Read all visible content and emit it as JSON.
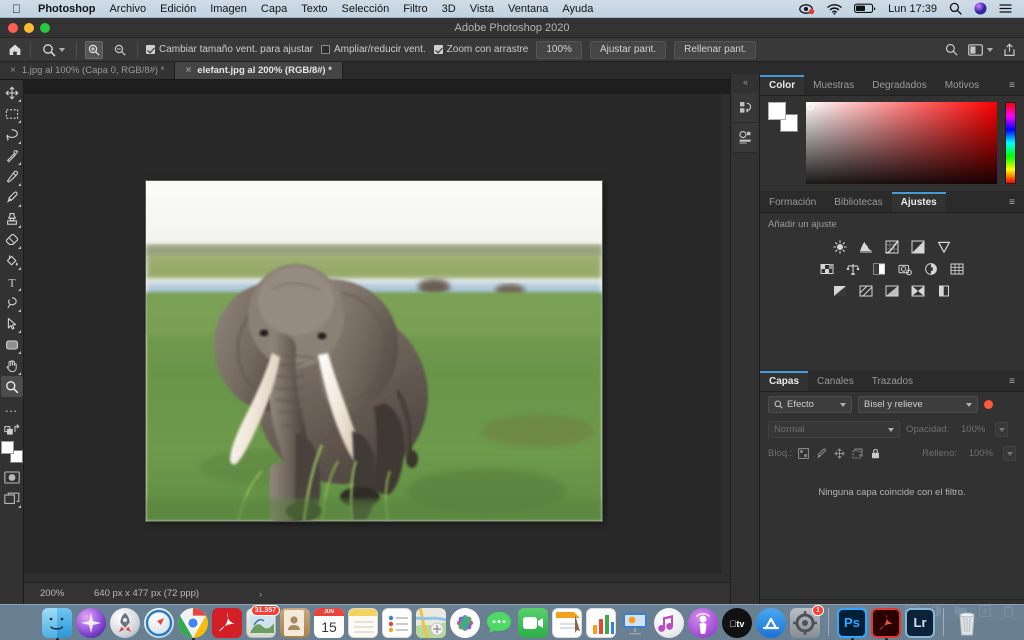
{
  "menubar": {
    "apple": "apple-logo",
    "items": [
      {
        "label": "Photoshop",
        "bold": true
      },
      {
        "label": "Archivo"
      },
      {
        "label": "Edición"
      },
      {
        "label": "Imagen"
      },
      {
        "label": "Capa"
      },
      {
        "label": "Texto"
      },
      {
        "label": "Selección"
      },
      {
        "label": "Filtro"
      },
      {
        "label": "3D"
      },
      {
        "label": "Vista"
      },
      {
        "label": "Ventana"
      },
      {
        "label": "Ayuda"
      }
    ],
    "status": {
      "screen_record_icon": "screen-record-icon",
      "wifi_icon": "wifi-icon",
      "battery_icon": "battery-icon",
      "clock": "Lun 17:39",
      "search_icon": "spotlight-search-icon",
      "siri_icon": "siri-icon",
      "control_center_icon": "control-center-icon"
    }
  },
  "window": {
    "title": "Adobe Photoshop 2020"
  },
  "options_bar": {
    "home_icon": "home-icon",
    "tool_icon": "zoom-tool-icon",
    "zoom_in_label": "zoom-in-icon",
    "zoom_out_label": "zoom-out-icon",
    "checkboxes": [
      {
        "label": "Cambiar tamaño vent. para ajustar",
        "checked": true
      },
      {
        "label": "Ampliar/reducir vent.",
        "checked": false
      },
      {
        "label": "Zoom con arrastre",
        "checked": true
      }
    ],
    "buttons": [
      {
        "label": "100%"
      },
      {
        "label": "Ajustar pant."
      },
      {
        "label": "Rellenar pant."
      }
    ],
    "right_icons": [
      "search-icon",
      "workspace-icon",
      "share-icon"
    ]
  },
  "tabs": [
    {
      "label": "1.jpg al 100% (Capa 0, RGB/8#) *",
      "active": false
    },
    {
      "label": "elefant.jpg al 200% (RGB/8#) *",
      "active": true
    }
  ],
  "tools": [
    {
      "name": "move-tool"
    },
    {
      "name": "marquee-tool"
    },
    {
      "name": "lasso-tool"
    },
    {
      "name": "quick-selection-tool"
    },
    {
      "name": "eyedropper-tool"
    },
    {
      "name": "brush-tool"
    },
    {
      "name": "clone-stamp-tool"
    },
    {
      "name": "eraser-tool"
    },
    {
      "name": "paint-bucket-tool"
    },
    {
      "name": "type-tool"
    },
    {
      "name": "pen-tool"
    },
    {
      "name": "path-selection-tool"
    },
    {
      "name": "shape-tool"
    },
    {
      "name": "hand-tool"
    },
    {
      "name": "zoom-tool"
    }
  ],
  "tool_extras": {
    "more_tools": "…",
    "foreground_color": "#ffffff",
    "background_color": "#ffffff",
    "quick_mask_icon": "quick-mask-icon",
    "screen_mode_icon": "screen-mode-icon"
  },
  "status_bar": {
    "zoom": "200%",
    "dimensions": "640 px x 477 px (72 ppp)",
    "chevron": "›"
  },
  "rail": {
    "expand_icon": "«",
    "icons": [
      "history-panel-icon",
      "properties-panel-icon"
    ]
  },
  "color_panel": {
    "tabs": [
      {
        "label": "Color",
        "active": true
      },
      {
        "label": "Muestras",
        "active": false
      },
      {
        "label": "Degradados",
        "active": false
      },
      {
        "label": "Motivos",
        "active": false
      }
    ],
    "menu_icon": "panel-menu-icon",
    "foreground": "#ffffff",
    "background": "#ffffff",
    "field_color": "#ff0000"
  },
  "adjustments_panel": {
    "tabs": [
      {
        "label": "Formación",
        "active": false
      },
      {
        "label": "Bibliotecas",
        "active": false
      },
      {
        "label": "Ajustes",
        "active": true
      }
    ],
    "menu_icon": "panel-menu-icon",
    "hint": "Añadir un ajuste",
    "rows": [
      [
        "brightness-contrast-icon",
        "levels-icon",
        "curves-icon",
        "exposure-icon",
        "vibrance-icon"
      ],
      [
        "hue-saturation-icon",
        "color-balance-icon",
        "black-white-icon",
        "photo-filter-icon",
        "channel-mixer-icon",
        "color-lookup-icon"
      ],
      [
        "invert-icon",
        "posterize-icon",
        "threshold-icon",
        "gradient-map-icon",
        "selective-color-icon"
      ]
    ]
  },
  "layers_panel": {
    "tabs": [
      {
        "label": "Capas",
        "active": true
      },
      {
        "label": "Canales",
        "active": false
      },
      {
        "label": "Trazados",
        "active": false
      }
    ],
    "menu_icon": "panel-menu-icon",
    "filter_type": "Efecto",
    "filter_value": "Bisel y relieve",
    "filter_toggle_color": "#ff5a3c",
    "blend_mode": "Normal",
    "opacity_label": "Opacidad:",
    "opacity_value": "100%",
    "lock_label": "Bloq.:",
    "lock_icons": [
      "lock-pixels-icon",
      "lock-image-icon",
      "lock-position-icon",
      "lock-artboard-icon",
      "lock-all-icon"
    ],
    "fill_label": "Relleno:",
    "fill_value": "100%",
    "empty_message": "Ninguna capa coincide con el filtro.",
    "footer_icons": [
      "link-layers-icon",
      "layer-style-fx-icon",
      "layer-mask-icon",
      "adjustment-layer-icon",
      "new-group-icon",
      "new-layer-icon",
      "delete-layer-icon"
    ]
  },
  "canvas": {
    "image_name": "elefant.jpg",
    "alt": "African elephant walking through green grassland with blurred water and sky"
  },
  "dock": {
    "items": [
      {
        "name": "finder",
        "running": true
      },
      {
        "name": "siri",
        "running": false
      },
      {
        "name": "launchpad",
        "running": false
      },
      {
        "name": "safari",
        "running": false
      },
      {
        "name": "chrome",
        "running": true
      },
      {
        "name": "acrobat-reader",
        "running": false
      },
      {
        "name": "mail",
        "running": false,
        "badge": "31.357"
      },
      {
        "name": "contacts",
        "running": false
      },
      {
        "name": "calendar",
        "running": false,
        "month": "JUN",
        "day": "15"
      },
      {
        "name": "notes",
        "running": false
      },
      {
        "name": "reminders",
        "running": false
      },
      {
        "name": "maps",
        "running": false
      },
      {
        "name": "photos",
        "running": false
      },
      {
        "name": "messages",
        "running": false
      },
      {
        "name": "facetime",
        "running": false
      },
      {
        "name": "pages",
        "running": false
      },
      {
        "name": "numbers",
        "running": false
      },
      {
        "name": "keynote",
        "running": false
      },
      {
        "name": "itunes",
        "running": false
      },
      {
        "name": "podcasts",
        "running": false
      },
      {
        "name": "apple-tv",
        "running": false
      },
      {
        "name": "app-store",
        "running": false
      },
      {
        "name": "system-preferences",
        "running": false,
        "badge": "1"
      },
      {
        "name": "separator"
      },
      {
        "name": "photoshop",
        "label": "Ps",
        "running": true
      },
      {
        "name": "acrobat",
        "running": true
      },
      {
        "name": "lightroom",
        "label": "Lr",
        "running": false
      },
      {
        "name": "separator2"
      },
      {
        "name": "trash",
        "running": false
      }
    ]
  }
}
